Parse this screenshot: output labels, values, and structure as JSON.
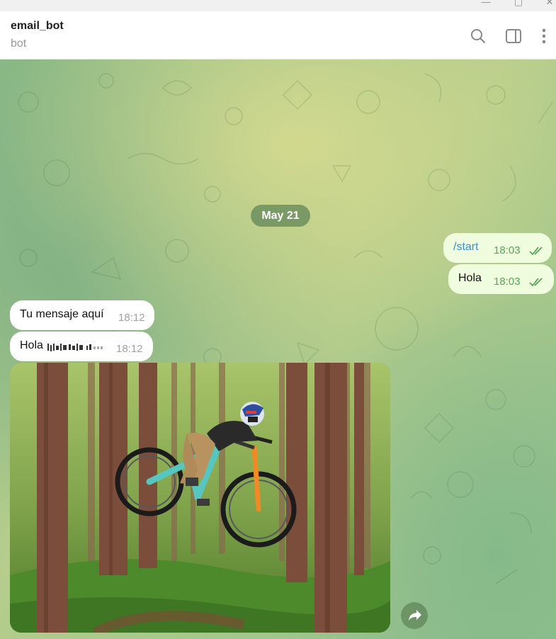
{
  "window": {
    "minimize_glyph": "—",
    "maximize_glyph": "▢",
    "close_glyph": "✕"
  },
  "header": {
    "title": "email_bot",
    "subtitle": "bot",
    "icons": [
      "search-icon",
      "sidebar-toggle-icon",
      "more-vert-icon"
    ]
  },
  "chat": {
    "date_separator": "May 21",
    "messages": [
      {
        "direction": "out",
        "text": "/start",
        "time": "18:03",
        "status": "read"
      },
      {
        "direction": "out",
        "text": "Hola",
        "time": "18:03",
        "status": "read"
      },
      {
        "direction": "in",
        "text": "Tu mensaje aquí",
        "time": "18:12"
      },
      {
        "direction": "in",
        "text": "Hola",
        "garbled_suffix": "ɯ",
        "time": "18:12"
      },
      {
        "direction": "in",
        "type": "photo",
        "photo_desc": "mountain bike rider jumping in forest"
      }
    ],
    "share_icon": "share-arrow-icon"
  },
  "colors": {
    "outgoing_bubble": "#effdde",
    "incoming_bubble": "#ffffff",
    "read_ticks": "#59a557",
    "date_pill": "#608658",
    "command_link": "#3a8fd6"
  }
}
